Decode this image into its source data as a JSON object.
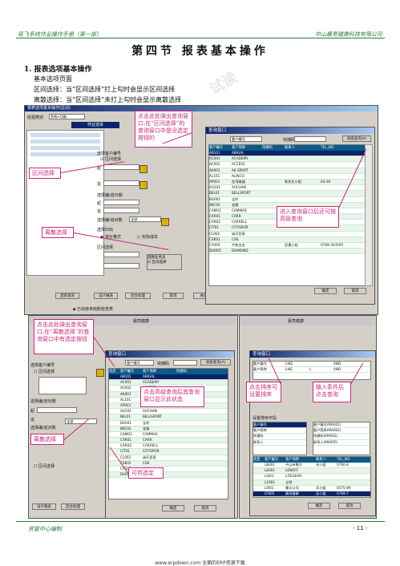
{
  "header": {
    "left": "易飞系统作业操作手册（第一部）",
    "right": "中山晨亮健康科技有限公司"
  },
  "section_title": "第四节  报表基本操作",
  "body": {
    "item1": "1. 报表选项基本操作",
    "line2": "基本选项页面",
    "line3": "区间选择：当“区间选择”打上勾时会显示区间选择",
    "line4": "离散选择：当“区间选择”未打上勾时会显示离散选择"
  },
  "callouts": {
    "c1": "点击此处弹出查询窗口,在“区间选择”的查询窗口中是没选定按钮的",
    "c2": "区间选择",
    "c3": "离散选择",
    "c4": "进入查询窗口后还可按高级查询",
    "c5": "点击此处弹出查询窗口,在“离散选择”的查询窗口中有选定按钮",
    "c6": "离散选择",
    "c7": "点击高级查询后其查询窗口显示此状态",
    "c8": "可供选定",
    "c9": "点击排序可设置排序",
    "c10": "输入条件后点击查询"
  },
  "screen1": {
    "title": "报表选项基本操作(区间)",
    "tab": "作业选单",
    "labels": {
      "label_a": "检视类别",
      "field_a": "系统+功能",
      "custno": "选择客户编号",
      "interval": "区间选择",
      "from": "起",
      "to": "迄",
      "dept": "选择编/道日期",
      "sel_all": "全部",
      "curr": "选择编/道对数",
      "curr_v": "全部",
      "print": "选择印出",
      "opt1": "单价格式",
      "opt2": "实际成本",
      "opt3": "选择业务员",
      "range2": "区间选择",
      "out": "输出"
    },
    "buttons": [
      "直接查询",
      "设计报表",
      "后台处理",
      "取消",
      "关闭"
    ],
    "query": {
      "title": "查询窗口",
      "search_label": "客户编号",
      "search_v": "客户编号",
      "col_label": "快捷码",
      "adv_label": "高级查询(A)",
      "headers": [
        "客户编号",
        "客户简称",
        "快捷码",
        "联系人",
        "TEL_NO"
      ],
      "rows": [
        [
          "AB101",
          "ABIGAL",
          "",
          "",
          ""
        ],
        [
          "AC001",
          "ACADEMY",
          "",
          "",
          ""
        ],
        [
          "AC002",
          "ACCESS",
          "",
          "",
          ""
        ],
        [
          "AK001",
          "AK SPORT",
          "",
          "",
          ""
        ],
        [
          "AL101",
          "ALINCO",
          "",
          "",
          ""
        ],
        [
          "AP001",
          "台湾电器",
          "",
          "陈先生小姐",
          "03-36"
        ],
        [
          "AU101",
          "AUCHAN",
          "",
          "",
          ""
        ],
        [
          "BEL01",
          "BELLSPORT",
          "",
          "",
          ""
        ],
        [
          "BG001",
          "宝利",
          "",
          "",
          ""
        ],
        [
          "BKC02",
          "宜康",
          "",
          "",
          ""
        ],
        [
          "CAM01",
          "CAMMAX",
          "",
          "",
          ""
        ],
        [
          "CAR01",
          "CARR",
          "",
          "",
          ""
        ],
        [
          "CAR02",
          "CARRELL",
          "",
          "",
          ""
        ],
        [
          "CIT01",
          "CITYSPOR",
          "",
          "",
          ""
        ],
        [
          "CL002",
          "诚乐贸易",
          "",
          "",
          ""
        ],
        [
          "CSK01",
          "CSK",
          "",
          "",
          ""
        ],
        [
          "CY005",
          "中和五金",
          "",
          "彭惠小姐",
          "0769-363595"
        ],
        [
          "DIA001",
          "DIAMOND",
          "",
          "",
          ""
        ]
      ],
      "ok": "确定",
      "cancel": "取消"
    },
    "status": "已出库未结账检查表"
  },
  "screen2": {
    "title_bar": "",
    "query_title": "查询窗口",
    "search_v": "客户编号",
    "kw": "快捷码",
    "adv": "高级查询(A)",
    "headers": [
      "选定",
      "客户编号",
      "客户简称",
      "快捷码"
    ],
    "rows": [
      [
        "",
        "AB101",
        "ABIGAL",
        ""
      ],
      [
        "",
        "AC001",
        "ACADEMY",
        ""
      ],
      [
        "",
        "AC002",
        "ACCESS",
        ""
      ],
      [
        "",
        "AK001",
        "AK SPORT",
        ""
      ],
      [
        "",
        "AL101",
        "ALINCO",
        ""
      ],
      [
        "",
        "AP001",
        "台湾电器",
        ""
      ],
      [
        "",
        "AU101",
        "AUCHAN",
        ""
      ],
      [
        "",
        "BEL01",
        "BELLSPORT",
        ""
      ],
      [
        "",
        "BG001",
        "宝利",
        ""
      ],
      [
        "",
        "BKC02",
        "宜康",
        ""
      ],
      [
        "",
        "CAM01",
        "CAMMAX",
        ""
      ],
      [
        "",
        "CAR01",
        "CARR",
        ""
      ],
      [
        "",
        "CAR02",
        "CARRELL",
        ""
      ],
      [
        "",
        "CIT01",
        "CITYSPOR",
        ""
      ],
      [
        "",
        "CL002",
        "诚乐贸易",
        ""
      ],
      [
        "",
        "CSK01",
        "CSK",
        ""
      ],
      [
        "",
        "CY005",
        "中和五金",
        ""
      ],
      [
        "",
        "DIA01",
        "DIAMOND",
        ""
      ]
    ],
    "left": {
      "brand": "晨亮健康",
      "custno": "选择客户编号",
      "interval": "区间选择",
      "from": "起",
      "to": "迄",
      "dept": "选择编/道日期",
      "sel_all": "全部",
      "curr": "选择编/道对数",
      "curr_v": "全部",
      "range2": "区间选择",
      "out": "输出"
    },
    "buttons": [
      "设计报表",
      "后台处理"
    ],
    "ok": "确定",
    "cancel": "取消"
  },
  "screen3": {
    "query_title": "查询窗口",
    "fields": [
      [
        "客户编号",
        "LIKE",
        ""
      ],
      [
        "客户简称",
        "LIKE",
        "L",
        ""
      ]
    ],
    "and": "AND",
    "sort_title": "设置排序字段",
    "sort_items": [
      "客户编号",
      "客户简称",
      "快捷码",
      "联系人"
    ],
    "sort_selected": [
      "客户编号(MA001)",
      "客户简称(MA002)",
      "快捷码(MA002)",
      "联系人(MA005)"
    ],
    "adv": "高级查询(A)",
    "headers": [
      "选定",
      "客户编号",
      "客户简称",
      "联系人",
      "TEL_NO"
    ],
    "rows": [
      [
        "",
        "LB001",
        "中山市聚大",
        "宋小姐",
        "0760-8"
      ],
      [
        "",
        "LE001",
        "LENOFF",
        "",
        ""
      ],
      [
        "",
        "LI001",
        "LIFEGEAR",
        "",
        ""
      ],
      [
        "",
        "L1001",
        "立明",
        "",
        ""
      ],
      [
        "",
        "LI001",
        "霖天公司",
        "邓小姐",
        "0575-89"
      ],
      [
        "",
        "LT005",
        "晨亮健康",
        "吴小姐",
        "0769-7"
      ]
    ],
    "ok": "确定",
    "cancel": "取消",
    "brand": "晨亮健康"
  },
  "footer": {
    "left": "资管中心编制",
    "page": "- 11 -",
    "url": "www.erpdown.com 全面的ERP资源下载"
  },
  "watermark": "试读"
}
